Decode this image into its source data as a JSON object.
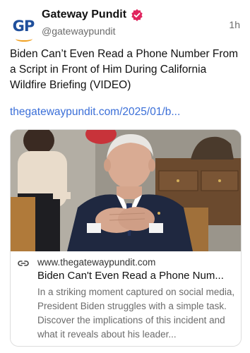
{
  "account": {
    "avatar_text": "GP",
    "display_name": "Gateway Pundit",
    "handle": "@gatewaypundit",
    "time": "1h"
  },
  "post": {
    "text": "Biden Can’t Even Read a Phone Number From a Script in Front of Him During California Wildfire Briefing (VIDEO)",
    "link": "thegatewaypundit.com/2025/01/b..."
  },
  "card": {
    "domain": "www.thegatewaypundit.com",
    "title": "Biden Can't Even Read a Phone Num...",
    "description": "In a striking moment captured on social media, President Biden struggles with a simple task. Discover the implications of this incident and what it reveals about his leader..."
  },
  "colors": {
    "link": "#3b6fd8",
    "verified_badge": "#e0245e",
    "brand_blue": "#1f4f9c",
    "brand_orange": "#f0a020"
  },
  "icons": {
    "verified": "verified-badge-icon",
    "card_link": "link-icon"
  }
}
